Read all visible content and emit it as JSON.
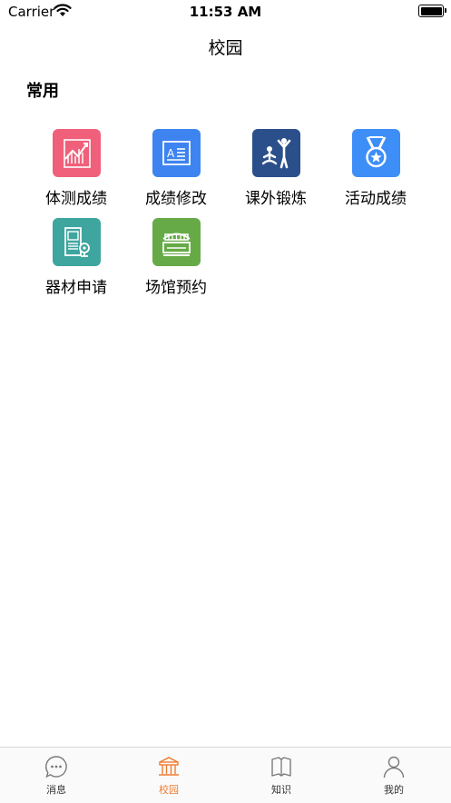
{
  "status_bar": {
    "carrier": "Carrier",
    "time": "11:53 AM",
    "icons": [
      "wifi-icon",
      "battery-icon"
    ]
  },
  "nav": {
    "title": "校园"
  },
  "section": {
    "title": "常用"
  },
  "apps": [
    {
      "label": "体测成绩",
      "icon": "chart-trend-icon",
      "color": "#f0607a"
    },
    {
      "label": "成绩修改",
      "icon": "edit-document-icon",
      "color": "#3d84f0"
    },
    {
      "label": "课外锻炼",
      "icon": "exercise-person-icon",
      "color": "#2b4f8a"
    },
    {
      "label": "活动成绩",
      "icon": "medal-icon",
      "color": "#3e8ef7"
    },
    {
      "label": "器材申请",
      "icon": "equipment-icon",
      "color": "#3ea59f"
    },
    {
      "label": "场馆预约",
      "icon": "stadium-icon",
      "color": "#66aa47"
    }
  ],
  "tabbar": {
    "tabs": [
      {
        "label": "消息",
        "icon": "message-icon",
        "active": false
      },
      {
        "label": "校园",
        "icon": "campus-icon",
        "active": true
      },
      {
        "label": "知识",
        "icon": "book-icon",
        "active": false
      },
      {
        "label": "我的",
        "icon": "profile-icon",
        "active": false
      }
    ],
    "active_color": "#f07c2f"
  }
}
